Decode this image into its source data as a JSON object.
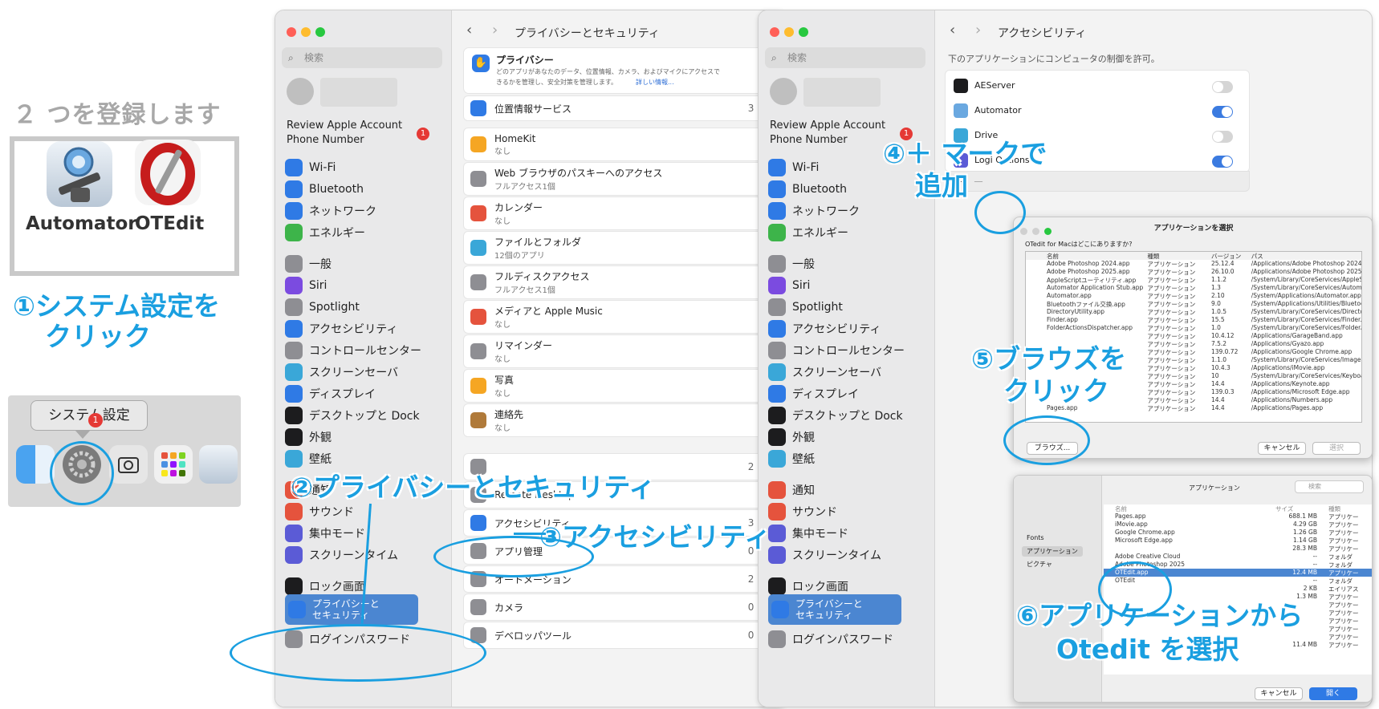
{
  "guide": {
    "title": "２ つを登録します",
    "app1": "Automator",
    "app2": "OTEdit",
    "step1a": "①システム設定を",
    "step1b": "クリック",
    "tooltip": "システム設定",
    "badge": "1",
    "step2": "②プライバシーとセキュリティ",
    "step3": "③アクセシビリティ",
    "step4a": "④＋ マークで",
    "step4b": "追加",
    "step5a": "⑤ブラウズを",
    "step5b": "クリック",
    "step6a": "⑥アプリケーションから",
    "step6b": "Otedit を選択"
  },
  "sidebar": {
    "search": "検索",
    "account1": "Review Apple Account",
    "account2": "Phone Number",
    "badge": "1",
    "items": [
      "Wi-Fi",
      "Bluetooth",
      "ネットワーク",
      "エネルギー",
      "一般",
      "Siri",
      "Spotlight",
      "アクセシビリティ",
      "コントロールセンター",
      "スクリーンセーバ",
      "ディスプレイ",
      "デスクトップと Dock",
      "外観",
      "壁紙",
      "通知",
      "サウンド",
      "集中モード",
      "スクリーンタイム",
      "ロック画面",
      "プライバシーと",
      "セキュリティ",
      "ログインパスワード"
    ]
  },
  "privacy": {
    "title": "プライバシーとセキュリティ",
    "head": "プライバシー",
    "desc1": "どのアプリがあなたのデータ、位置情報、カメラ、およびマイクにアクセスで",
    "desc2": "きるかを管理し、安全対策を管理します。",
    "more": "詳しい情報...",
    "rows": [
      {
        "label": "位置情報サービス",
        "sub": "",
        "count": "3"
      },
      {
        "label": "HomeKit",
        "sub": "なし",
        "count": ""
      },
      {
        "label": "Web ブラウザのパスキーへのアクセス",
        "sub": "フルアクセス1個",
        "count": ""
      },
      {
        "label": "カレンダー",
        "sub": "なし",
        "count": ""
      },
      {
        "label": "ファイルとフォルダ",
        "sub": "12個のアプリ",
        "count": ""
      },
      {
        "label": "フルディスクアクセス",
        "sub": "フルアクセス1個",
        "count": ""
      },
      {
        "label": "メディアと Apple Music",
        "sub": "なし",
        "count": ""
      },
      {
        "label": "リマインダー",
        "sub": "なし",
        "count": ""
      },
      {
        "label": "写真",
        "sub": "なし",
        "count": ""
      },
      {
        "label": "連絡先",
        "sub": "なし",
        "count": ""
      }
    ],
    "rows2": [
      {
        "label": "",
        "count": "2"
      },
      {
        "label": "Remote Desktop",
        "count": ""
      },
      {
        "label": "アクセシビリティ",
        "count": "3"
      },
      {
        "label": "アプリ管理",
        "count": "0"
      },
      {
        "label": "オートメーション",
        "count": "2"
      },
      {
        "label": "カメラ",
        "count": "0"
      },
      {
        "label": "デベロッパツール",
        "count": "0"
      }
    ]
  },
  "access": {
    "title": "アクセシビリティ",
    "desc": "下のアプリケーションにコンピュータの制御を許可。",
    "apps": [
      {
        "name": "AEServer",
        "on": false
      },
      {
        "name": "Automator",
        "on": true
      },
      {
        "name": "Drive",
        "on": false
      },
      {
        "name": "Logi Options+",
        "on": true
      }
    ],
    "plus": "＋",
    "minus": "－"
  },
  "chooser": {
    "title": "アプリケーションを選択",
    "question": "OTedit for Macはどこにありますか?",
    "cols": [
      "名前",
      "種類",
      "バージョン",
      "パス"
    ],
    "rows": [
      [
        "Adobe Photoshop 2024.app",
        "アプリケーション",
        "25.12.4",
        "/Applications/Adobe Photoshop 2024/"
      ],
      [
        "Adobe Photoshop 2025.app",
        "アプリケーション",
        "26.10.0",
        "/Applications/Adobe Photoshop 2025/"
      ],
      [
        "AppleScriptユーティリティ.app",
        "アプリケーション",
        "1.1.2",
        "/System/Library/CoreServices/AppleSc"
      ],
      [
        "Automator Application Stub.app",
        "アプリケーション",
        "1.3",
        "/System/Library/CoreServices/Automat"
      ],
      [
        "Automator.app",
        "アプリケーション",
        "2.10",
        "/System/Applications/Automator.app"
      ],
      [
        "Bluetoothファイル交換.app",
        "アプリケーション",
        "9.0",
        "/System/Applications/Utilities/Bluetoot"
      ],
      [
        "DirectoryUtility.app",
        "アプリケーション",
        "1.0.5",
        "/System/Library/CoreServices/Director"
      ],
      [
        "Finder.app",
        "アプリケーション",
        "15.5",
        "/System/Library/CoreServices/Finder.a"
      ],
      [
        "FolderActionsDispatcher.app",
        "アプリケーション",
        "1.0",
        "/System/Library/CoreServices/FolderAc"
      ],
      [
        "",
        "アプリケーション",
        "10.4.12",
        "/Applications/GarageBand.app"
      ],
      [
        "",
        "アプリケーション",
        "7.5.2",
        "/Applications/Gyazo.app"
      ],
      [
        "",
        "アプリケーション",
        "139.0.72",
        "/Applications/Google Chrome.app"
      ],
      [
        "",
        "アプリケーション",
        "1.1.0",
        "/System/Library/CoreServices/Image E"
      ],
      [
        "",
        "アプリケーション",
        "10.4.3",
        "/Applications/iMovie.app"
      ],
      [
        "",
        "アプリケーション",
        "10",
        "/System/Library/CoreServices/Keyboa"
      ],
      [
        "",
        "アプリケーション",
        "14.4",
        "/Applications/Keynote.app"
      ],
      [
        "",
        "アプリケーション",
        "139.0.3",
        "/Applications/Microsoft Edge.app"
      ],
      [
        "",
        "アプリケーション",
        "14.4",
        "/Applications/Numbers.app"
      ],
      [
        "Pages.app",
        "アプリケーション",
        "14.4",
        "/Applications/Pages.app"
      ]
    ],
    "browse": "ブラウズ...",
    "cancel": "キャンセル",
    "ok": "選択"
  },
  "finder": {
    "path": "アプリケーション",
    "search": "検索",
    "cols": [
      "名前",
      "サイズ",
      "種類"
    ],
    "side": [
      "Fonts",
      "アプリケーション",
      "ピクチャ"
    ],
    "rows": [
      [
        "Pages.app",
        "688.1 MB",
        "アプリケー"
      ],
      [
        "iMovie.app",
        "4.29 GB",
        "アプリケー"
      ],
      [
        "Google Chrome.app",
        "1.26 GB",
        "アプリケー"
      ],
      [
        "Microsoft Edge.app",
        "1.14 GB",
        "アプリケー"
      ],
      [
        "",
        "28.3 MB",
        "アプリケー"
      ],
      [
        "Adobe Creative Cloud",
        "--",
        "フォルダ"
      ],
      [
        "Adobe Photoshop 2025",
        "--",
        "フォルダ"
      ],
      [
        "OTEdit.app",
        "12.4 MB",
        "アプリケー"
      ],
      [
        "OTEdit",
        "--",
        "フォルダ"
      ],
      [
        "",
        "2 KB",
        "エイリアス"
      ],
      [
        "",
        "1.3 MB",
        "アプリケー"
      ],
      [
        "",
        "",
        "アプリケー"
      ],
      [
        "",
        "",
        "アプリケー"
      ],
      [
        "",
        "",
        "アプリケー"
      ],
      [
        "",
        "",
        "アプリケー"
      ],
      [
        "",
        "",
        "アプリケー"
      ],
      [
        "",
        "11.4 MB",
        "アプリケー"
      ]
    ],
    "cancel": "キャンセル",
    "open": "開く"
  },
  "colors": {
    "accent": "#1a9fe0",
    "selection": "#4b86d1",
    "toggle_on": "#3b7be0"
  }
}
